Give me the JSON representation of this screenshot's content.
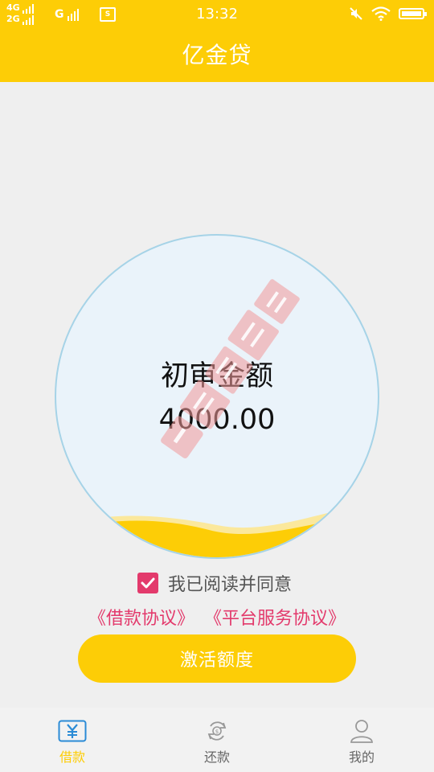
{
  "status_bar": {
    "net_1": "4G",
    "net_2": "2G",
    "net_3": "G",
    "message_icon_text": "S",
    "time": "13:32",
    "icons": [
      "signal-bars-icon",
      "message-icon",
      "mute-icon",
      "wifi-icon",
      "battery-icon"
    ]
  },
  "header": {
    "title": "亿金贷"
  },
  "main": {
    "circle_label": "初审金额",
    "amount": "4000.00",
    "agree_checked": true,
    "agree_text": "我已阅读并同意",
    "loan_agreement_link": "《借款协议》",
    "service_agreement_link": "《平台服务协议》",
    "activate_button": "激活额度"
  },
  "tabbar": {
    "tabs": [
      {
        "label": "借款",
        "icon": "yen-icon",
        "active": true
      },
      {
        "label": "还款",
        "icon": "repay-icon",
        "active": false
      },
      {
        "label": "我的",
        "icon": "user-icon",
        "active": false
      }
    ]
  },
  "colors": {
    "primary": "#fdcd06",
    "accent": "#e33a6c",
    "circle_fill": "#eaf3fa",
    "circle_border": "#a6d3e7",
    "background": "#efefef"
  }
}
